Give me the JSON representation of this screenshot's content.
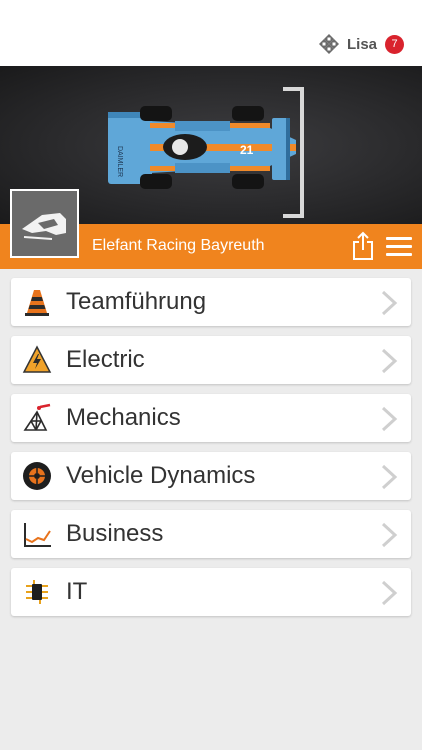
{
  "header": {
    "user_name": "Lisa",
    "notification_count": "7"
  },
  "team": {
    "name": "Elefant Racing Bayreuth"
  },
  "menu": {
    "items": [
      {
        "label": "Teamführung",
        "icon": "traffic-cone-icon"
      },
      {
        "label": "Electric",
        "icon": "high-voltage-icon"
      },
      {
        "label": "Mechanics",
        "icon": "truss-frame-icon"
      },
      {
        "label": "Vehicle Dynamics",
        "icon": "wheel-icon"
      },
      {
        "label": "Business",
        "icon": "line-chart-icon"
      },
      {
        "label": "IT",
        "icon": "microchip-icon"
      }
    ]
  },
  "colors": {
    "accent": "#f0841e",
    "badge": "#d9232d",
    "background": "#ececec"
  }
}
